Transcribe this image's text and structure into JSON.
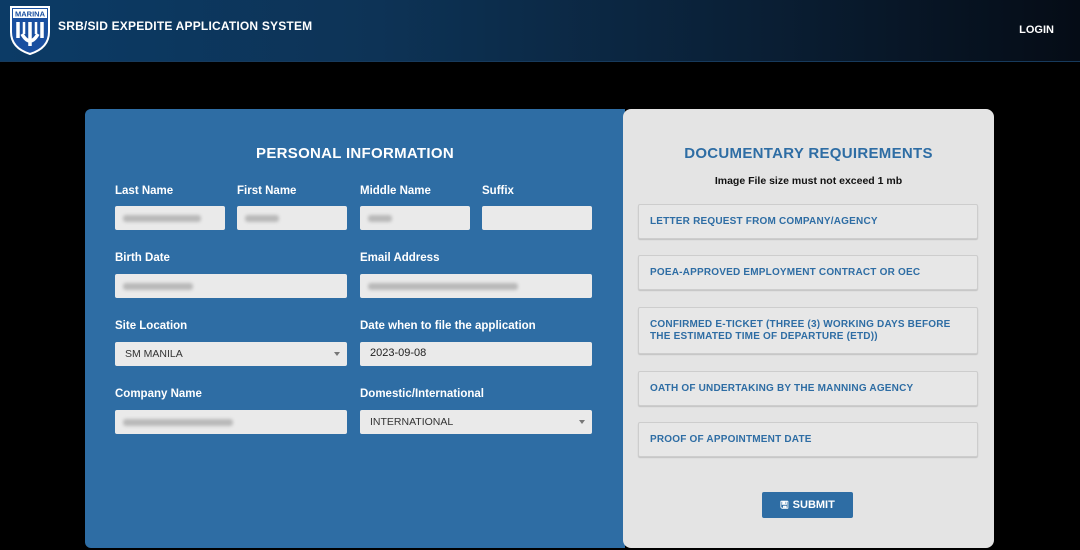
{
  "header": {
    "logo_text": "MARINA",
    "app_title": "SRB/SID EXPEDITE APPLICATION SYSTEM",
    "login_label": "LOGIN"
  },
  "personal": {
    "title": "PERSONAL INFORMATION",
    "last_name_label": "Last Name",
    "first_name_label": "First Name",
    "middle_name_label": "Middle Name",
    "suffix_label": "Suffix",
    "birth_date_label": "Birth Date",
    "email_label": "Email Address",
    "site_location_label": "Site Location",
    "site_location_value": "SM MANILA",
    "file_date_label": "Date when to file the application",
    "file_date_value": "2023-09-08",
    "company_label": "Company Name",
    "domestic_label": "Domestic/International",
    "domestic_value": "INTERNATIONAL"
  },
  "documents": {
    "title": "DOCUMENTARY REQUIREMENTS",
    "note": "Image File size must not exceed 1 mb",
    "items": [
      {
        "label": "LETTER REQUEST FROM COMPANY/AGENCY"
      },
      {
        "label": "POEA-APPROVED EMPLOYMENT CONTRACT OR OEC"
      },
      {
        "label": "CONFIRMED E-TICKET (THREE (3) WORKING DAYS BEFORE THE ESTIMATED TIME OF DEPARTURE (ETD))"
      },
      {
        "label": "OATH OF UNDERTAKING BY THE MANNING AGENCY"
      },
      {
        "label": "PROOF OF APPOINTMENT DATE"
      }
    ],
    "submit_label": "SUBMIT",
    "submit_icon": "floppy-disk-icon"
  },
  "colors": {
    "accent": "#2e6da4",
    "panel_bg": "#e4e4e4",
    "header_dark": "#0a1f35"
  }
}
